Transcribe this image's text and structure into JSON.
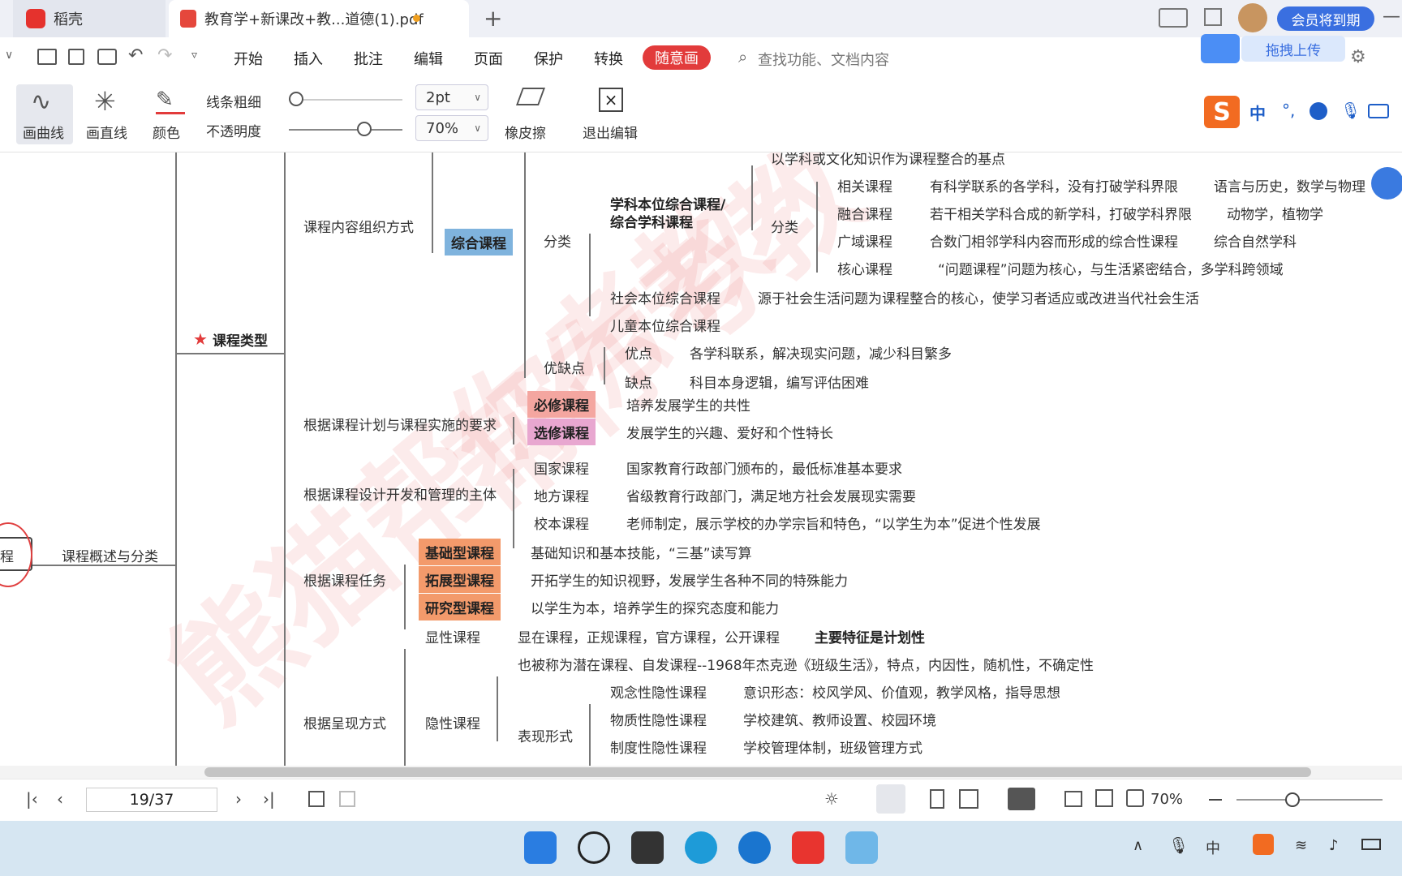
{
  "tabs": [
    {
      "label": "稻壳"
    },
    {
      "label": "教育学+新课改+教...道德(1).pdf"
    }
  ],
  "topright": {
    "member": "会员将到期",
    "upload": "拖拽上传"
  },
  "menu": [
    "开始",
    "插入",
    "批注",
    "编辑",
    "页面",
    "保护",
    "转换",
    "随意画"
  ],
  "search": {
    "placeholder": "查找功能、文档内容"
  },
  "toolbar": {
    "curve": "画曲线",
    "straight": "画直线",
    "color": "颜色",
    "thickness": "线条粗细",
    "opacity": "不透明度",
    "thickness_val": "2pt",
    "opacity_val": "70%",
    "eraser": "橡皮擦",
    "exit": "退出编辑"
  },
  "ime": {
    "lang": "中"
  },
  "mindmap": {
    "root": "程",
    "level1": "课程概述与分类",
    "star": "课程类型",
    "top_cut": "以学科或文化知识作为课程整合的基点",
    "b1": "课程内容组织方式",
    "zonghe": "综合课程",
    "fenlei1": "分类",
    "xueke": "学科本位综合课程/",
    "xueke2": "综合学科课程",
    "fenlei2": "分类",
    "rows": [
      {
        "a": "相关课程",
        "b": "有科学联系的各学科，没有打破学科界限",
        "c": "语言与历史，数学与物理"
      },
      {
        "a": "融合课程",
        "b": "若干相关学科合成的新学科，打破学科界限",
        "c": "动物学，植物学"
      },
      {
        "a": "广域课程",
        "b": "合数门相邻学科内容而形成的综合性课程",
        "c": "综合自然学科"
      },
      {
        "a": "核心课程",
        "b": "“问题课程”问题为核心，与生活紧密结合，多学科跨领域",
        "c": ""
      }
    ],
    "shehui": "社会本位综合课程",
    "shehui_d": "源于社会生活问题为课程整合的核心，使学习者适应或改进当代社会生活",
    "ertong": "儿童本位综合课程",
    "youque": "优缺点",
    "you": "优点",
    "you_d": "各学科联系，解决现实问题，减少科目繁多",
    "que": "缺点",
    "que_d": "科目本身逻辑，编写评估困难",
    "b2": "根据课程计划与课程实施的要求",
    "bixiu": "必修课程",
    "bixiu_d": "培养发展学生的共性",
    "xuanxiu": "选修课程",
    "xuanxiu_d": "发展学生的兴趣、爱好和个性特长",
    "b3": "根据课程设计开发和管理的主体",
    "b3rows": [
      {
        "a": "国家课程",
        "b": "国家教育行政部门颁布的，最低标准基本要求"
      },
      {
        "a": "地方课程",
        "b": "省级教育行政部门，满足地方社会发展现实需要"
      },
      {
        "a": "校本课程",
        "b": "老师制定，展示学校的办学宗旨和特色，“以学生为本”促进个性发展"
      }
    ],
    "b4": "根据课程任务",
    "b4rows": [
      {
        "a": "基础型课程",
        "b": "基础知识和基本技能，“三基”读写算"
      },
      {
        "a": "拓展型课程",
        "b": "开拓学生的知识视野，发展学生各种不同的特殊能力"
      },
      {
        "a": "研究型课程",
        "b": "以学生为本，培养学生的探究态度和能力"
      }
    ],
    "b5": "根据呈现方式",
    "xianxing": "显性课程",
    "xianxing_d": "显在课程，正规课程，官方课程，公开课程",
    "xianxing_k": "主要特征是计划性",
    "yinxing": "隐性课程",
    "yinxing_d": "也被称为潜在课程、自发课程--1968年杰克逊《班级生活》，特点，内因性，随机性，不确定性",
    "biaoxian": "表现形式",
    "yrows": [
      {
        "a": "观念性隐性课程",
        "b": "意识形态：校风学风、价值观，教学风格，指导思想"
      },
      {
        "a": "物质性隐性课程",
        "b": "学校建筑、教师设置、校园环境"
      },
      {
        "a": "制度性隐性课程",
        "b": "学校管理体制，班级管理方式"
      }
    ]
  },
  "status": {
    "page": "19/37",
    "zoom": "70%"
  },
  "colors": {
    "zonghe": "#7fb3dd",
    "bixiu": "#f4a6a0",
    "xuanxiu": "#e8a7d0",
    "task": "#f39a6b",
    "accent": "#e23b3b"
  }
}
